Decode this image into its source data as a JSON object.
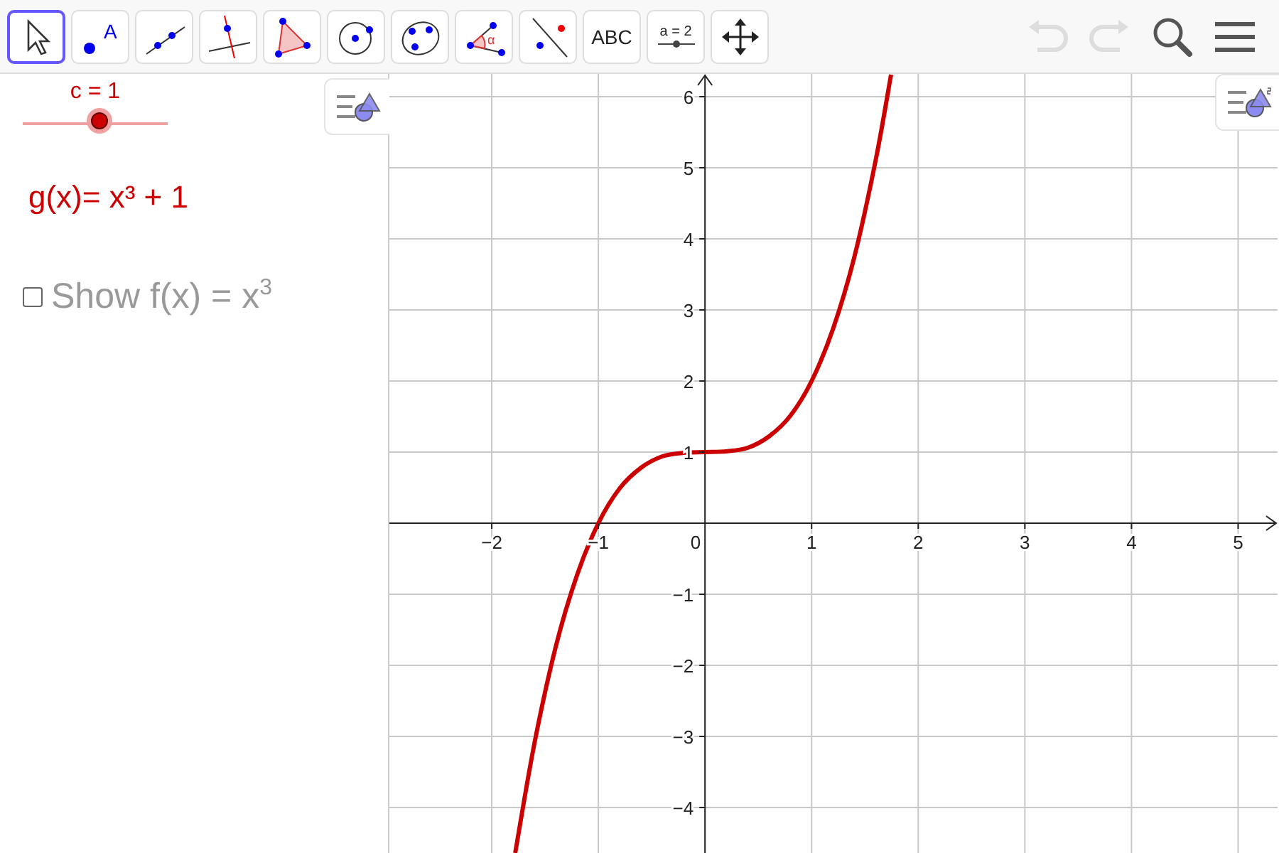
{
  "toolbar": {
    "tools": [
      {
        "kind": "move",
        "selected": true
      },
      {
        "kind": "point",
        "label": "A",
        "selected": false
      },
      {
        "kind": "line",
        "selected": false
      },
      {
        "kind": "perpendicular",
        "selected": false
      },
      {
        "kind": "polygon",
        "selected": false
      },
      {
        "kind": "circle",
        "selected": false
      },
      {
        "kind": "conic",
        "selected": false
      },
      {
        "kind": "angle",
        "label": "α",
        "selected": false
      },
      {
        "kind": "reflect",
        "selected": false
      },
      {
        "kind": "text",
        "label": "ABC",
        "selected": false
      },
      {
        "kind": "slider",
        "label": "a = 2",
        "selected": false
      },
      {
        "kind": "move-view",
        "selected": false
      }
    ],
    "actions": [
      {
        "kind": "undo",
        "disabled": true
      },
      {
        "kind": "redo",
        "disabled": true
      },
      {
        "kind": "search",
        "disabled": false
      },
      {
        "kind": "menu",
        "disabled": false
      }
    ]
  },
  "algebra": {
    "slider": {
      "label": "c = 1",
      "level": 0.53
    },
    "function": "g(x)= x³ + 1",
    "checkbox": {
      "label": "Show f(x) = x$^{3}$",
      "checked": false
    }
  },
  "graphics": {
    "chart_data": {
      "type": "line",
      "grid": true,
      "x": [
        -1.78,
        -1.6,
        -1.4,
        -1.2,
        -1.0,
        -0.8,
        -0.6,
        -0.4,
        -0.2,
        0,
        0.2,
        0.4,
        0.6,
        0.8,
        1.0,
        1.2,
        1.4,
        1.6,
        1.745
      ],
      "series": [
        {
          "color": "#cc0000",
          "values": [
            -4.64,
            -3.1,
            -1.74,
            -0.73,
            0,
            0.49,
            0.78,
            0.94,
            0.99,
            1,
            1.01,
            1.06,
            1.22,
            1.51,
            2,
            2.73,
            3.74,
            5.1,
            6.31
          ]
        }
      ],
      "xlim": [
        -2.96,
        5.37
      ],
      "ylim": [
        -4.64,
        6.32
      ],
      "xticks": [
        {
          "value": -2,
          "label": "−2"
        },
        {
          "value": -1,
          "label": "−1"
        },
        {
          "value": 0,
          "label": "0"
        },
        {
          "value": 1,
          "label": "1"
        },
        {
          "value": 2,
          "label": "2"
        },
        {
          "value": 3,
          "label": "3"
        },
        {
          "value": 4,
          "label": "4"
        },
        {
          "value": 5,
          "label": "5"
        }
      ],
      "yticks": [
        {
          "value": -4,
          "label": "−4"
        },
        {
          "value": -3,
          "label": "−3"
        },
        {
          "value": -2,
          "label": "−2"
        },
        {
          "value": -1,
          "label": "−1"
        },
        {
          "value": 1,
          "label": "1"
        },
        {
          "value": 2,
          "label": "2"
        },
        {
          "value": 3,
          "label": "3"
        },
        {
          "value": 4,
          "label": "4"
        },
        {
          "value": 5,
          "label": "5"
        },
        {
          "value": 6,
          "label": "6"
        }
      ]
    }
  }
}
